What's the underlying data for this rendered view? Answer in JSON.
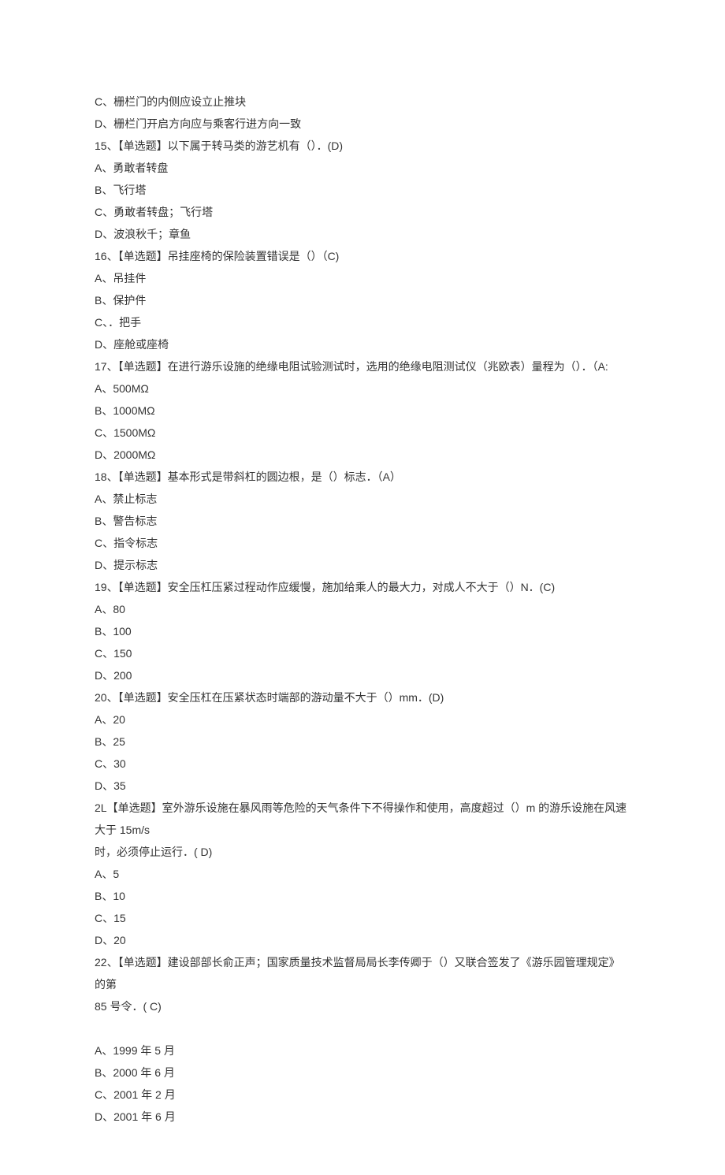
{
  "lines": [
    "C、栅栏门的内侧应设立止推块",
    "D、栅栏门开启方向应与乘客行进方向一致",
    "15、【单选题】以下属于转马类的游艺机有（）．(D)",
    "A、勇敢者转盘",
    "B、飞行塔",
    "C、勇敢者转盘；飞行塔",
    "D、波浪秋千；章鱼",
    "16、【单选题】吊挂座椅的保险装置错误是（）（C)",
    "A、吊挂件",
    "B、保护件",
    "C、．把手",
    "D、座舱或座椅",
    "17、【单选题】在进行游乐设施的绝缘电阻试验测试时，选用的绝缘电阻测试仪（兆欧表）量程为（）．（A:",
    "A、500MΩ",
    "B、1000MΩ",
    "C、1500MΩ",
    "D、2000MΩ",
    "18、【单选题】基本形式是带斜杠的圆边根，是（）标志．（A）",
    "A、禁止标志",
    "B、警告标志",
    "C、指令标志",
    "D、提示标志",
    "19、【单选题】安全压杠压紧过程动作应缓慢，施加给乘人的最大力，对成人不大于（）N．(C)",
    "A、80",
    "B、100",
    "C、150",
    "D、200",
    "20、【单选题】安全压杠在压紧状态时端部的游动量不大于（）mm．(D)",
    "A、20",
    "B、25",
    "C、30",
    "D、35",
    "2L【单选题】室外游乐设施在暴风雨等危险的天气条件下不得操作和使用，高度超过（）m 的游乐设施在风速大于 15m/s",
    "时，必须停止运行．( D)",
    "A、5",
    "B、10",
    "C、15",
    "D、20",
    "22、【单选题】建设部部长俞正声；国家质量技术监督局局长李传卿于（）又联合签发了《游乐园管理规定》的第",
    "85 号令．( C)",
    "",
    "A、1999 年 5 月",
    "B、2000 年 6 月",
    "C、2001 年 2 月",
    "D、2001 年 6 月"
  ]
}
